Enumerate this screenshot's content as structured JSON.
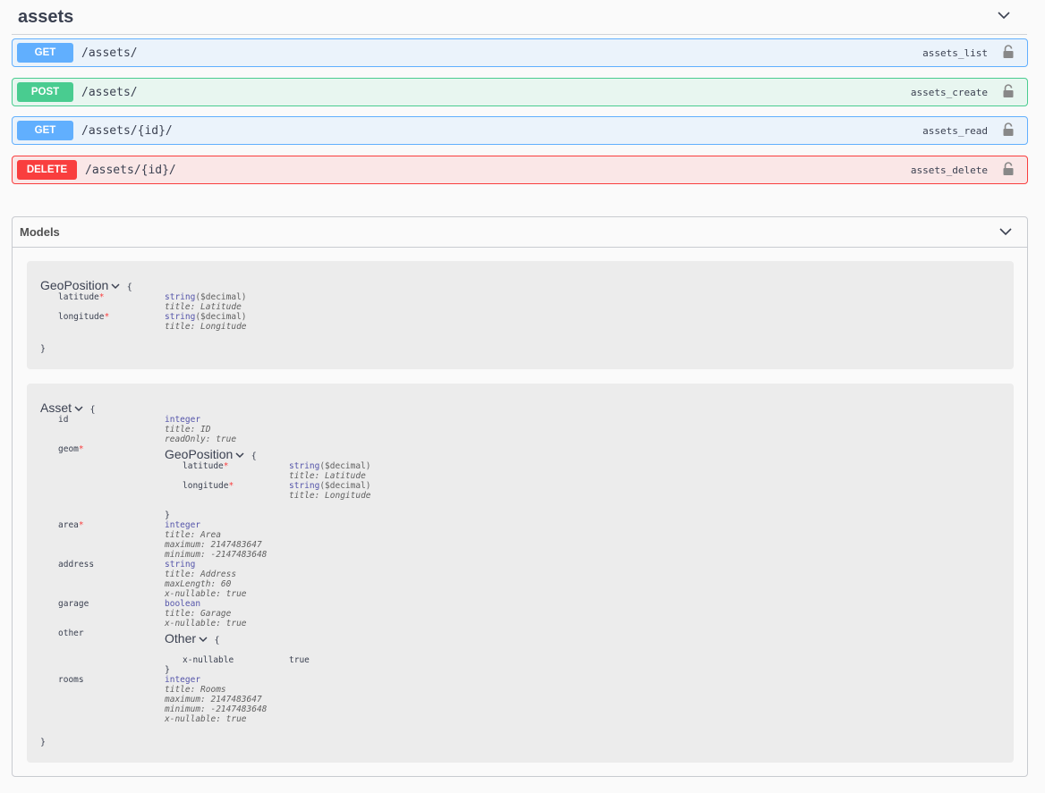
{
  "tag": {
    "title": "assets"
  },
  "operations": [
    {
      "method": "GET",
      "path": "/assets/",
      "operation_id": "assets_list"
    },
    {
      "method": "POST",
      "path": "/assets/",
      "operation_id": "assets_create"
    },
    {
      "method": "GET",
      "path": "/assets/{id}/",
      "operation_id": "assets_read"
    },
    {
      "method": "DELETE",
      "path": "/assets/{id}/",
      "operation_id": "assets_delete"
    }
  ],
  "models": {
    "title": "Models",
    "open_brace": "{",
    "close_brace": "}",
    "required_mark": "*",
    "geo": {
      "name": "GeoPosition",
      "props": [
        {
          "name": "latitude",
          "type": "string",
          "format": "($decimal)",
          "meta": [
            "title: Latitude"
          ]
        },
        {
          "name": "longitude",
          "type": "string",
          "format": "($decimal)",
          "meta": [
            "title: Longitude"
          ]
        }
      ]
    },
    "asset": {
      "name": "Asset",
      "id": {
        "name": "id",
        "type": "integer",
        "meta": [
          "title: ID",
          "readOnly: true"
        ]
      },
      "geom": {
        "name": "geom"
      },
      "area": {
        "name": "area",
        "type": "integer",
        "meta": [
          "title: Area",
          "maximum: 2147483647",
          "minimum: -2147483648"
        ]
      },
      "address": {
        "name": "address",
        "type": "string",
        "meta": [
          "title: Address",
          "maxLength: 60",
          "x-nullable: true"
        ]
      },
      "garage": {
        "name": "garage",
        "type": "boolean",
        "meta": [
          "title: Garage",
          "x-nullable: true"
        ]
      },
      "other": {
        "name": "other",
        "model_name": "Other",
        "key": "x-nullable",
        "value": "true"
      },
      "rooms": {
        "name": "rooms",
        "type": "integer",
        "meta": [
          "title: Rooms",
          "maximum: 2147483647",
          "minimum: -2147483648",
          "x-nullable: true"
        ]
      }
    }
  }
}
